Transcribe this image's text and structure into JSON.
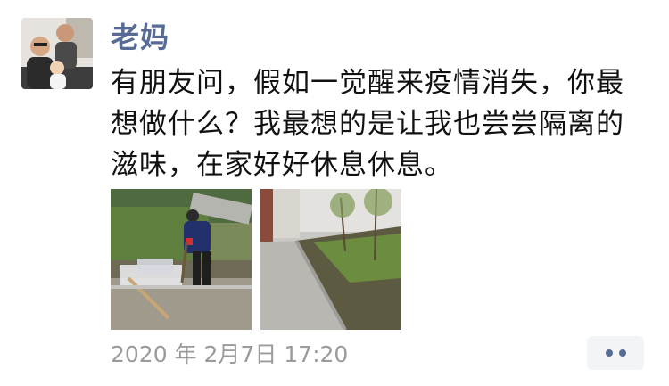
{
  "post": {
    "author": "老妈",
    "content": "有朋友问，假如一觉醒来疫情消失，你最想做什么？我最想的是让我也尝尝隔离的滋味，在家好好休息休息。",
    "timestamp": "2020 年 2月7日 17:20",
    "photos": [
      {
        "name": "photo-person-sweeping"
      },
      {
        "name": "photo-courtyard-garden"
      }
    ]
  },
  "actions": {
    "more_icon": "ellipsis-icon"
  },
  "colors": {
    "author_name": "#576b95",
    "text": "#111111",
    "timestamp": "#9b9b9b",
    "action_bg": "#f3f4f6"
  }
}
